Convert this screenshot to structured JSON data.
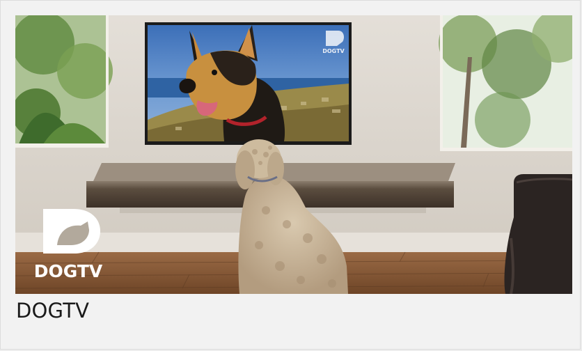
{
  "card": {
    "title": "DOGTV",
    "thumbnail": {
      "alt_subject": "dog watching dog on television",
      "logo_text": "DOGTV",
      "tv_logo_text": "DOGTV",
      "logo_icon": "dogtv-logo-icon"
    }
  },
  "colors": {
    "background": "#f2f2f2",
    "caption_text": "#1a1a1a",
    "logo_white": "#ffffff"
  }
}
